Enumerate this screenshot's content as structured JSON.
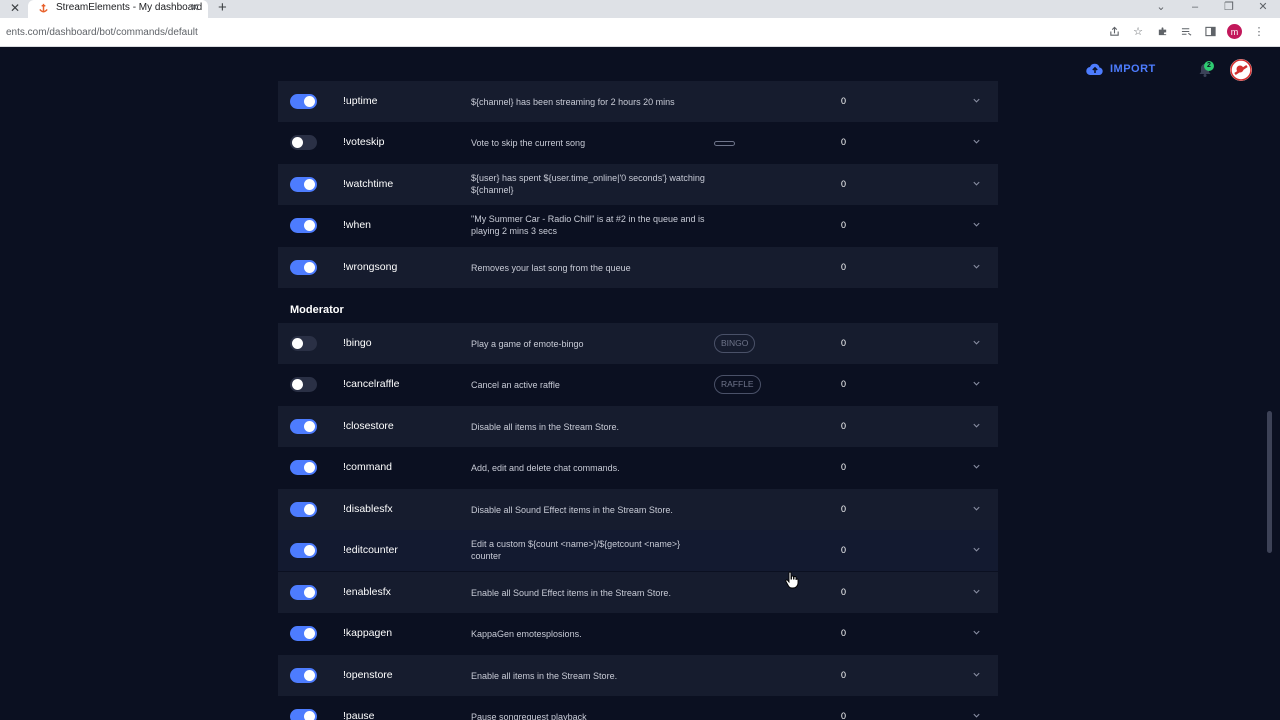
{
  "browser": {
    "tab_title": "StreamElements - My dashboard",
    "url": "ents.com/dashboard/bot/commands/default",
    "profile_letter": "m"
  },
  "header": {
    "import_label": "IMPORT",
    "notification_count": "2"
  },
  "rows_top": [
    {
      "enabled": true,
      "command": "!uptime",
      "description": "${channel} has been streaming for 2 hours 20 mins",
      "tag": "",
      "count": "0"
    },
    {
      "enabled": false,
      "command": "!voteskip",
      "description": "Vote to skip the current song",
      "tag": "",
      "count": "0"
    },
    {
      "enabled": true,
      "command": "!watchtime",
      "description": "${user} has spent ${user.time_online|'0 seconds'} watching ${channel}",
      "tag": "",
      "count": "0"
    },
    {
      "enabled": true,
      "command": "!when",
      "description": "\"My Summer Car - Radio Chill\" is at #2 in the queue and is playing 2 mins 3 secs",
      "tag": "",
      "count": "0"
    },
    {
      "enabled": true,
      "command": "!wrongsong",
      "description": "Removes your last song from the queue",
      "tag": "",
      "count": "0"
    }
  ],
  "section_label": "Moderator",
  "rows_moderator": [
    {
      "enabled": false,
      "command": "!bingo",
      "description": "Play a game of emote-bingo",
      "tag": "BINGO",
      "count": "0"
    },
    {
      "enabled": false,
      "command": "!cancelraffle",
      "description": "Cancel an active raffle",
      "tag": "RAFFLE",
      "count": "0"
    },
    {
      "enabled": true,
      "command": "!closestore",
      "description": "Disable all items in the Stream Store.",
      "tag": "",
      "count": "0"
    },
    {
      "enabled": true,
      "command": "!command",
      "description": "Add, edit and delete chat commands.",
      "tag": "",
      "count": "0"
    },
    {
      "enabled": true,
      "command": "!disablesfx",
      "description": "Disable all Sound Effect items in the Stream Store.",
      "tag": "",
      "count": "0"
    },
    {
      "enabled": true,
      "command": "!editcounter",
      "description": "Edit a custom ${count <name>}/${getcount <name>} counter",
      "tag": "",
      "count": "0"
    },
    {
      "enabled": true,
      "command": "!enablesfx",
      "description": "Enable all Sound Effect items in the Stream Store.",
      "tag": "",
      "count": "0"
    },
    {
      "enabled": true,
      "command": "!kappagen",
      "description": "KappaGen emotesplosions.",
      "tag": "",
      "count": "0"
    },
    {
      "enabled": true,
      "command": "!openstore",
      "description": "Enable all items in the Stream Store.",
      "tag": "",
      "count": "0"
    },
    {
      "enabled": true,
      "command": "!pause",
      "description": "Pause songrequest playback",
      "tag": "",
      "count": "0"
    }
  ],
  "colors": {
    "background": "#0b1021",
    "row_shaded": "#161c2e",
    "accent": "#4d7cfe",
    "toggle_off": "#2a3045"
  }
}
